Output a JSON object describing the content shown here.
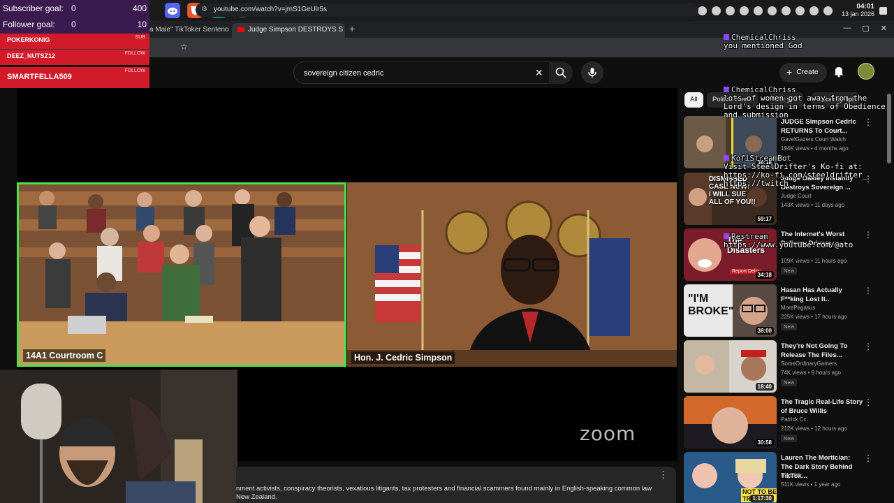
{
  "overlay": {
    "subscriber_label": "Subscriber goal:",
    "subscriber_current": "0",
    "subscriber_target": "400",
    "follower_label": "Follower goal:",
    "follower_current": "0",
    "follower_target": "10",
    "alerts": [
      {
        "name": "POKERKONIG",
        "tag": "SUB"
      },
      {
        "name": "DEEZ_NUTSZ12",
        "tag": "FOLLOW"
      },
      {
        "name": "SMARTFELLA509",
        "tag": "FOLLOW"
      }
    ]
  },
  "tray": {
    "time": "04:01",
    "date": "13 jan 2026"
  },
  "browser": {
    "tabs": [
      "a Male\" TikToker Sentence",
      "Judge Simpson DESTROYS S"
    ],
    "new_tab": "+",
    "url": "youtube.com/watch?v=jmS1GeUlr5s"
  },
  "youtube": {
    "search_query": "sovereign citizen cedric",
    "create_label": "Create",
    "video": {
      "left_panel_label": "14A1 Courtroom C",
      "right_panel_label": "Hon. J. Cedric Simpson",
      "zoom_logo": "zoom"
    },
    "description": "nment activists, conspiracy theorists, vexatious litigants, tax protesters and financial scammers found mainly in English-speaking common law New Zealand.",
    "chips": [
      "All",
      "Politics News",
      "For you",
      "Recently upl"
    ],
    "recommendations": [
      {
        "title": "JUDGE Simpson Cedric RETURNS To Court... ",
        "channel": "GavelGazers Court Watch",
        "meta": "194K views • 4 months ago",
        "duration": "36:18",
        "new": ""
      },
      {
        "title": "Judge Oakley Instantly Destroys Sovereign ...",
        "channel": "Judge Court",
        "meta": "143K views • 11 days ago",
        "duration": "59:17",
        "new": ""
      },
      {
        "title": "The Internet's Worst Delivery Drivers...",
        "channel": "",
        "meta": "109K views • 11 hours ago",
        "duration": "34:18",
        "new": "New"
      },
      {
        "title": "Hasan Has Actually F**king Lost It..",
        "channel": "MorePegasus",
        "meta": "225K views • 17 hours ago",
        "duration": "38:00",
        "new": "New"
      },
      {
        "title": "They're Not Going To Release The Files...",
        "channel": "SomeOrdinaryGamers",
        "meta": "74K views • 9 hours ago",
        "duration": "18:40",
        "new": "New"
      },
      {
        "title": "The Tragic Real-Life Story of Bruce Willis",
        "channel": "Patrick Cc:",
        "meta": "212K views • 12 hours ago",
        "duration": "30:58",
        "new": "New"
      },
      {
        "title": "Lauren The Mortician: The Dark Story Behind TikTok...",
        "channel": "Repzilla",
        "meta": "511K views • 1 year ago",
        "duration": "1:17:30",
        "new": ""
      }
    ],
    "thumb_text": {
      "t2": "DISMISSED\nCASE NOW!\nI WILL SUE\nALL OF YOU!!",
      "t3": "The\nDisasters",
      "t3_badge": "Report Deliv",
      "t4": "\"I'M\nBROKE\"",
      "t5": "NOT TO BE\nTRU"
    }
  },
  "chat": [
    {
      "user": "ChemicalChriss",
      "text": "you mentioned God"
    },
    {
      "user": "ChemicalChriss",
      "text": "lots of women got away from the Lord's design in terms of Obedience and submission"
    },
    {
      "user": "KofiStreamBot",
      "text": "Visit SteelDrifter's Ko-fi at: https://ko-fi.com/steeldrifter_ https://twitch"
    },
    {
      "user": "Restream",
      "text": "https://www.youtube.com/@ato"
    }
  ],
  "colors": {
    "accent_green": "#4ae14a",
    "youtube_red": "#ff0000",
    "alert_red": "#d11a2a",
    "overlay_purple": "#3b1b4f"
  }
}
